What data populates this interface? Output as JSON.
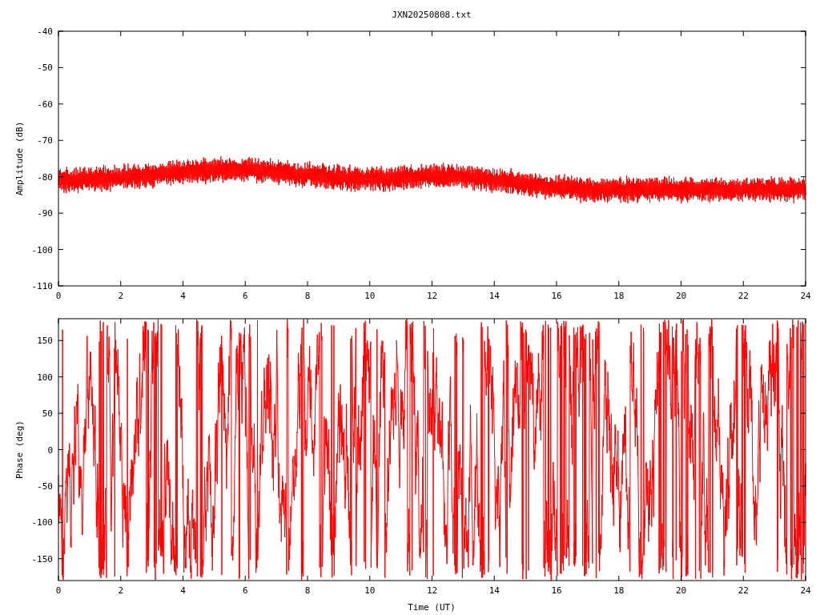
{
  "title": "JXN20250808.txt",
  "plots": [
    {
      "kind": "amplitude",
      "ylabel": "Amplitude (dB)",
      "yticks": [
        "-40",
        "-50",
        "-60",
        "-70",
        "-80",
        "-90",
        "-100",
        "-110"
      ],
      "xticks": [
        "0",
        "2",
        "4",
        "6",
        "8",
        "10",
        "12",
        "14",
        "16",
        "18",
        "20",
        "22",
        "24"
      ]
    },
    {
      "kind": "phase",
      "ylabel": "Phase (deg)",
      "yticks": [
        "150",
        "100",
        "50",
        "0",
        "-50",
        "-100",
        "-150"
      ],
      "xticks": [
        "0",
        "2",
        "4",
        "6",
        "8",
        "10",
        "12",
        "14",
        "16",
        "18",
        "20",
        "22",
        "24"
      ],
      "xlabel": "Time (UT)"
    }
  ]
}
